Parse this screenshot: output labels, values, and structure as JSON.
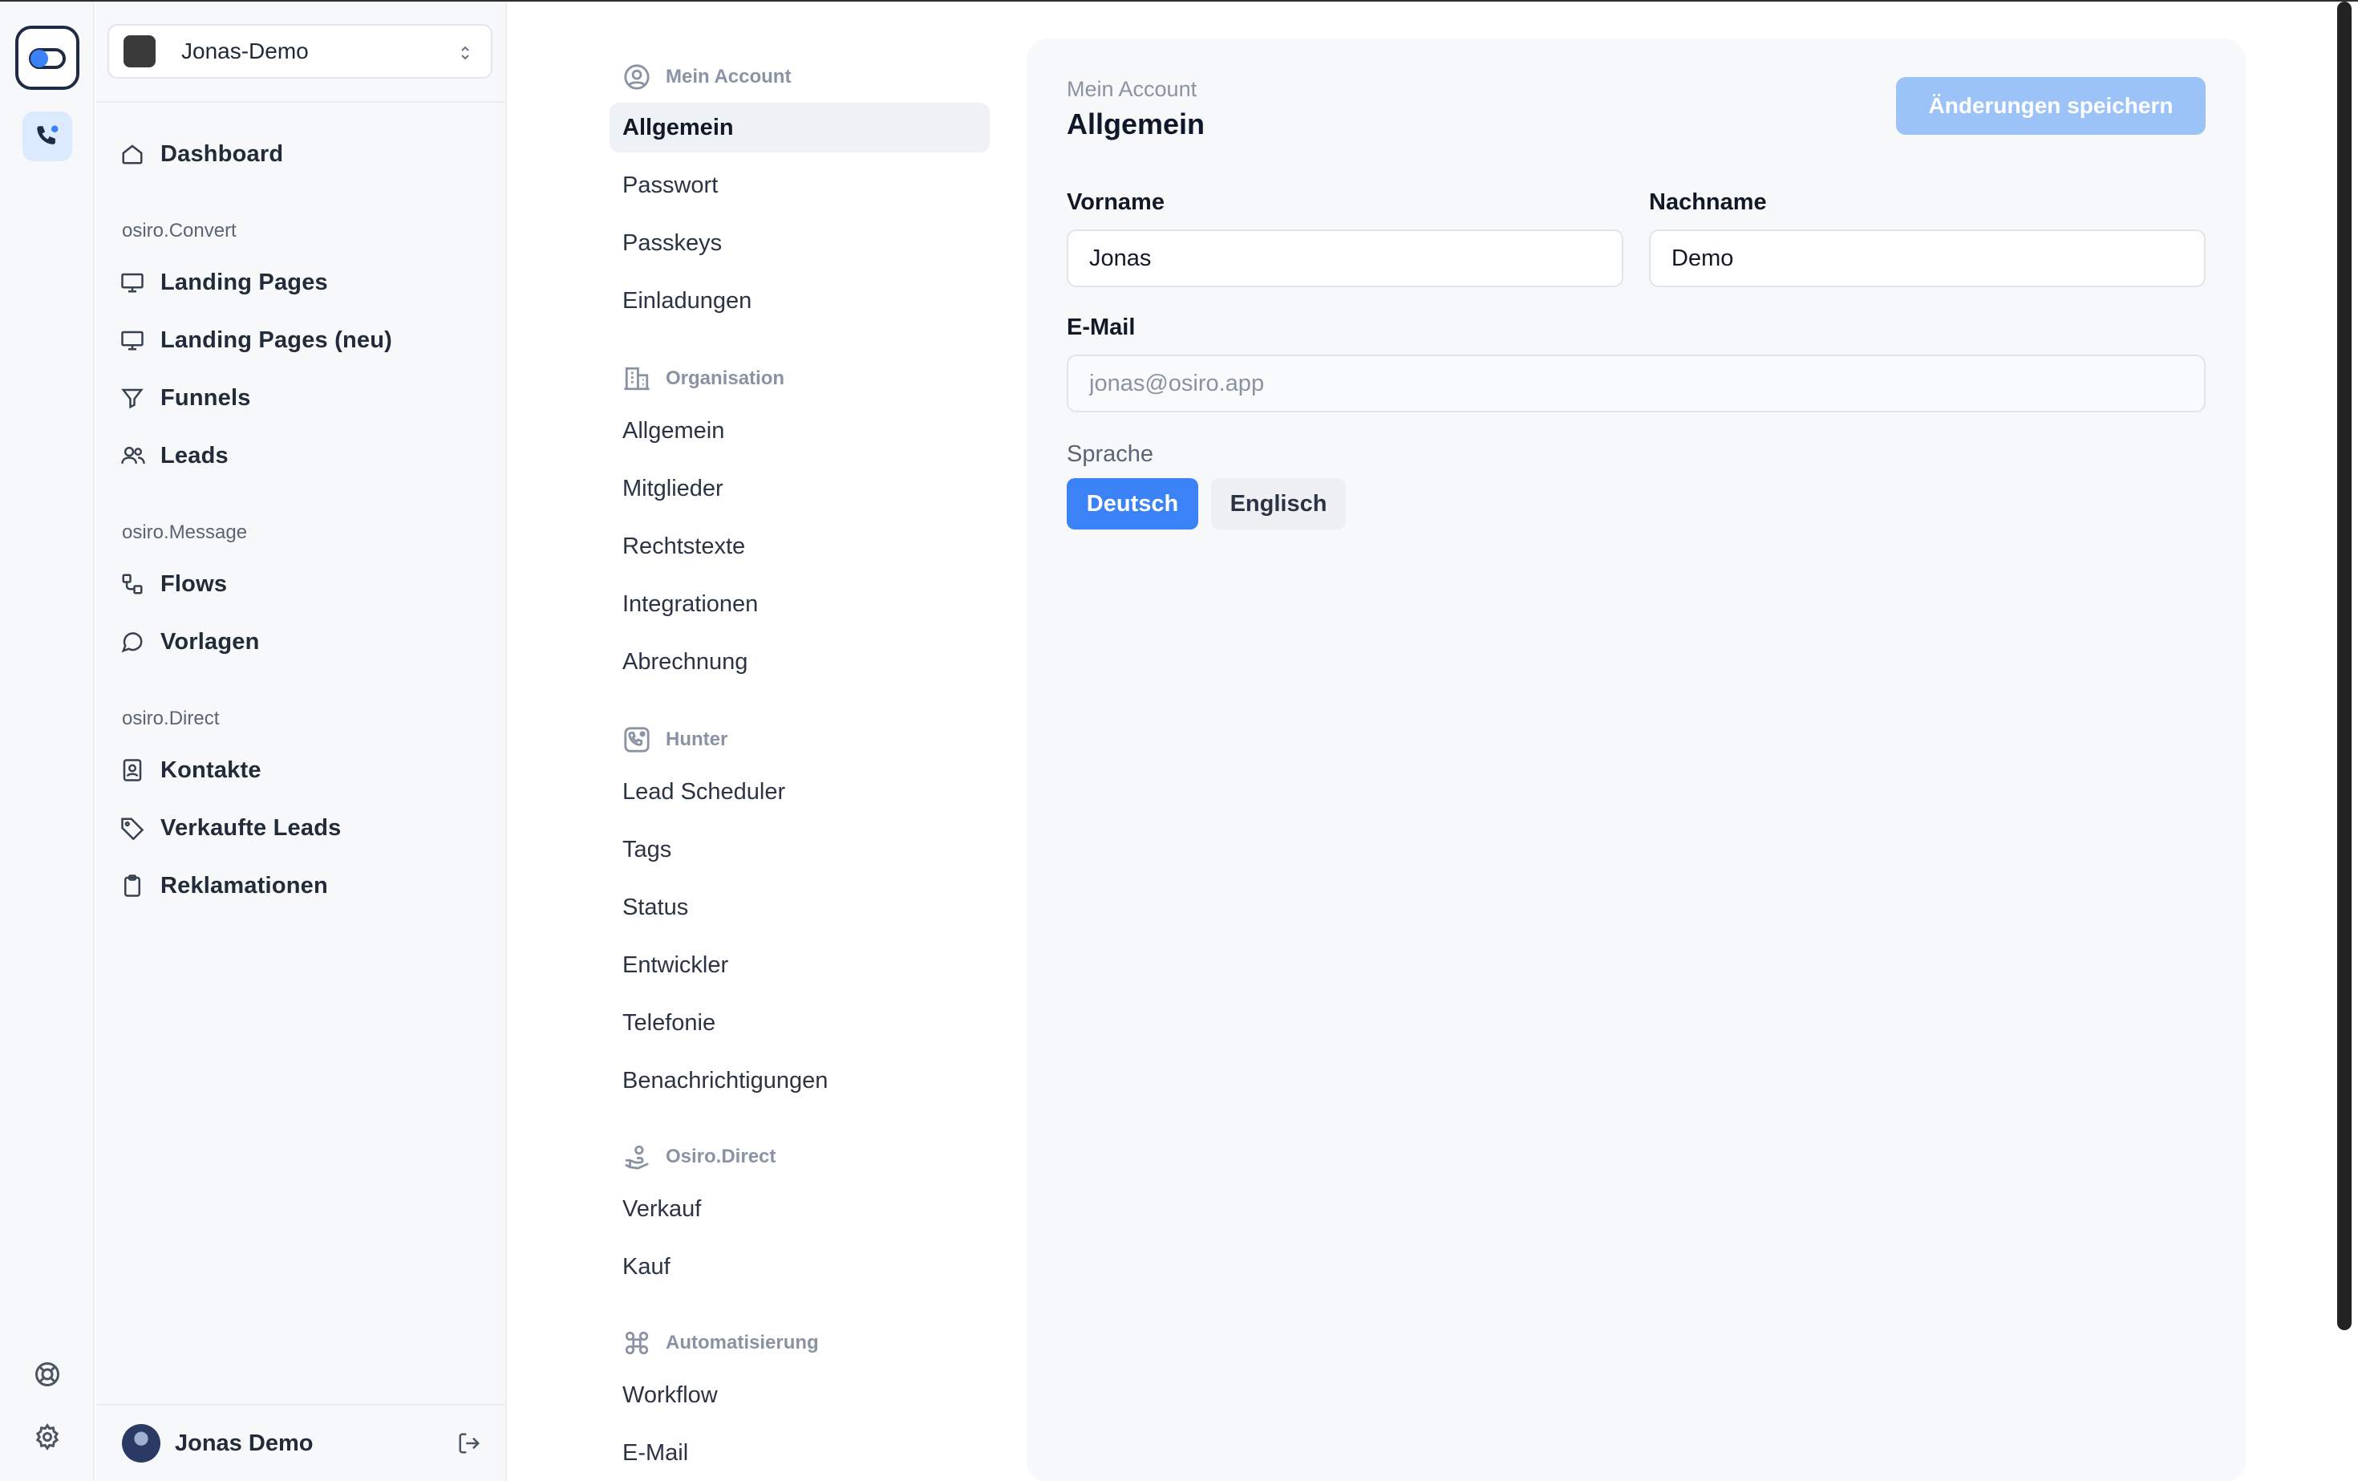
{
  "app": {
    "workspace": "Jonas-Demo",
    "user_name": "Jonas Demo"
  },
  "sidebar": {
    "dashboard": "Dashboard",
    "sections": {
      "convert": "osiro.Convert",
      "message": "osiro.Message",
      "direct": "osiro.Direct"
    },
    "items": {
      "landing_pages": "Landing Pages",
      "landing_pages_new": "Landing Pages (neu)",
      "funnels": "Funnels",
      "leads": "Leads",
      "flows": "Flows",
      "vorlagen": "Vorlagen",
      "kontakte": "Kontakte",
      "verkaufte_leads": "Verkaufte Leads",
      "reklamationen": "Reklamationen"
    }
  },
  "settings_nav": {
    "groups": {
      "account": "Mein Account",
      "organisation": "Organisation",
      "hunter": "Hunter",
      "direct": "Osiro.Direct",
      "automation": "Automatisierung"
    },
    "account_items": [
      "Allgemein",
      "Passwort",
      "Passkeys",
      "Einladungen"
    ],
    "organisation_items": [
      "Allgemein",
      "Mitglieder",
      "Rechtstexte",
      "Integrationen",
      "Abrechnung"
    ],
    "hunter_items": [
      "Lead Scheduler",
      "Tags",
      "Status",
      "Entwickler",
      "Telefonie",
      "Benachrichtigungen"
    ],
    "direct_items": [
      "Verkauf",
      "Kauf"
    ],
    "automation_items": [
      "Workflow",
      "E-Mail"
    ]
  },
  "content": {
    "breadcrumb": "Mein Account",
    "title": "Allgemein",
    "save_label": "Änderungen speichern",
    "first_name_label": "Vorname",
    "first_name_value": "Jonas",
    "last_name_label": "Nachname",
    "last_name_value": "Demo",
    "email_label": "E-Mail",
    "email_value": "jonas@osiro.app",
    "language_label": "Sprache",
    "language_options": [
      "Deutsch",
      "Englisch"
    ],
    "language_selected": "Deutsch"
  },
  "colors": {
    "accent": "#3b82f6",
    "accent_disabled": "#9cc3f8",
    "sidebar_bg": "#f7f8fa"
  }
}
